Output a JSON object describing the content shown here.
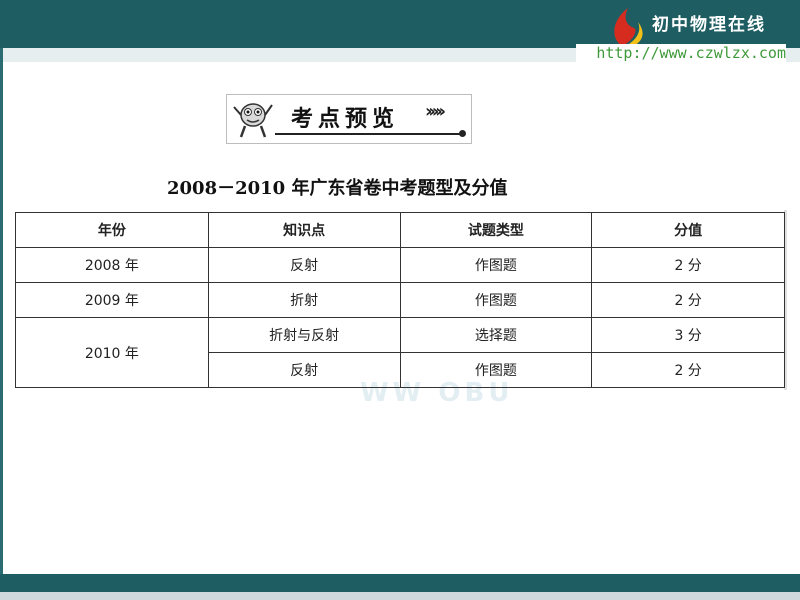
{
  "brand": {
    "name": "初中物理在线",
    "url": "http://www.czwlzx.com",
    "colors": {
      "frame": "#1e5e63",
      "url_text": "#3f9a3b",
      "logo_red": "#d62b1f",
      "logo_yellow": "#f2c018"
    }
  },
  "section_header": {
    "title": "考点预览",
    "icon": "mascot-icon"
  },
  "table": {
    "title": "2008－2010 年广东省卷中考题型及分值",
    "columns": [
      "年份",
      "知识点",
      "试题类型",
      "分值"
    ],
    "rows": [
      {
        "year": "2008 年",
        "topic": "反射",
        "type": "作图题",
        "score": "2 分"
      },
      {
        "year": "2009 年",
        "topic": "折射",
        "type": "作图题",
        "score": "2 分"
      },
      {
        "year": "2010 年",
        "topic": "折射与反射",
        "type": "选择题",
        "score": "3 分"
      },
      {
        "year": "",
        "topic": "反射",
        "type": "作图题",
        "score": "2 分"
      }
    ]
  }
}
